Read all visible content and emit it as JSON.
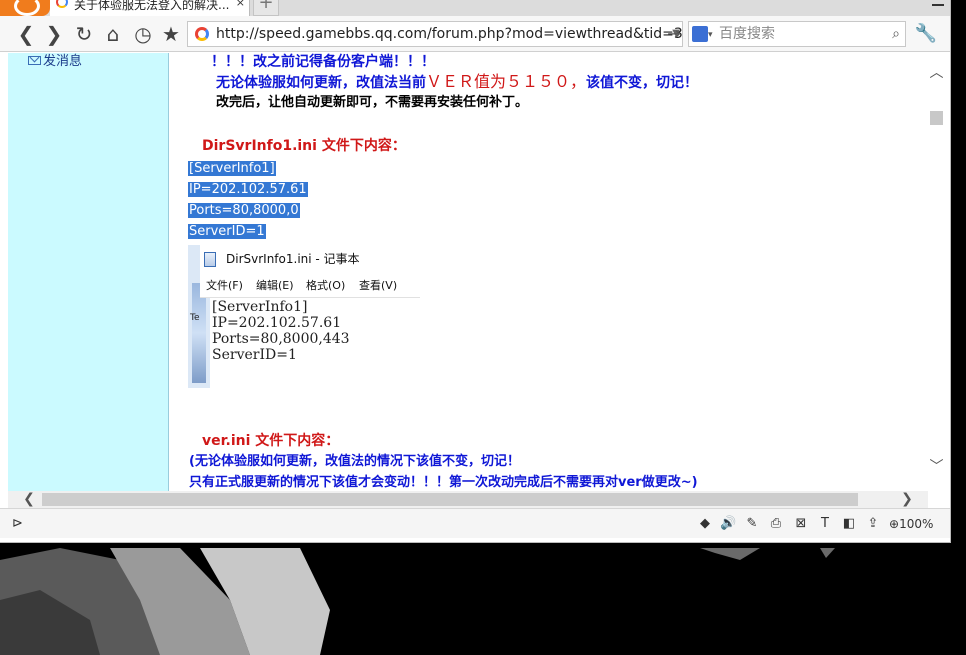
{
  "browser": {
    "tab_title": "关于体验服无法登入的解决...",
    "tab_close": "×",
    "new_tab": "+",
    "address_url": "http://speed.gamebbs.qq.com/forum.php?mod=viewthread&tid=348",
    "search_placeholder": "百度搜索",
    "zoom": "100%"
  },
  "sidebar": {
    "send_message": "发消息"
  },
  "content": {
    "line1": "！！！改之前记得备份客户端！！！",
    "line2a": "无论体验服如何更新，改值法当前",
    "line2b": "ＶＥＲ值为５１５０，",
    "line2c": "该值不变，切记！",
    "line3": "改完后，让他自动更新即可，不需要再安装任何补丁。",
    "heading_dirsvr": "DirSvrInfo1.ini  文件下内容：",
    "code": [
      "[ServerInfo1]",
      "IP=202.102.57.61",
      "Ports=80,8000,0",
      "ServerID=1"
    ],
    "heading_ver": "ver.ini  文件下内容：",
    "ver_line1": "(无论体验服如何更新，改值法的情况下该值不变，切记！",
    "ver_line2": "只有正式服更新的情况下该值才会变动！！！第一次改动完成后不需要再对ver做更改~)"
  },
  "notepad": {
    "title": "DirSvrInfo1.ini - 记事本",
    "menu": [
      "文件(F)",
      "编辑(E)",
      "格式(O)",
      "查看(V)"
    ],
    "text": [
      "[ServerInfo1]",
      "IP=202.102.57.61",
      "Ports=80,8000,443",
      "ServerID=1"
    ],
    "side_label": "Te"
  },
  "colors": {
    "sidebar_bg": "#cbfaff",
    "blue_text": "#0f17d6",
    "red_text": "#d01818",
    "selection": "#3478d4"
  }
}
